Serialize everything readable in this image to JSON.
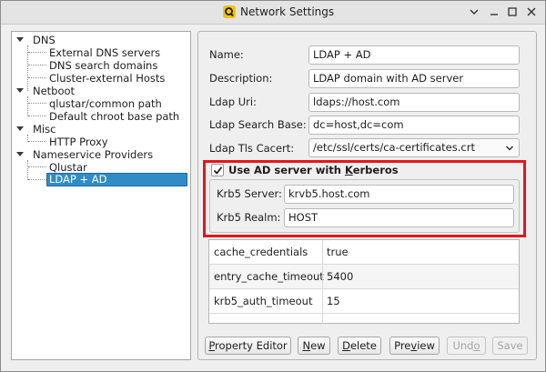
{
  "window": {
    "title": "Network Settings"
  },
  "tree": {
    "items": [
      {
        "label": "DNS",
        "level": 0,
        "expanded": true
      },
      {
        "label": "External DNS servers",
        "level": 1
      },
      {
        "label": "DNS search domains",
        "level": 1
      },
      {
        "label": "Cluster-external Hosts",
        "level": 1
      },
      {
        "label": "Netboot",
        "level": 0,
        "expanded": true
      },
      {
        "label": "qlustar/common path",
        "level": 1
      },
      {
        "label": "Default chroot base path",
        "level": 1
      },
      {
        "label": "Misc",
        "level": 0,
        "expanded": true
      },
      {
        "label": "HTTP Proxy",
        "level": 1
      },
      {
        "label": "Nameservice Providers",
        "level": 0,
        "expanded": true
      },
      {
        "label": "Qlustar",
        "level": 1
      },
      {
        "label": "LDAP + AD",
        "level": 1,
        "selected": true
      }
    ]
  },
  "form": {
    "name_label": "Name:",
    "name_value": "LDAP + AD",
    "description_label": "Description:",
    "description_value": "LDAP domain with AD server",
    "uri_label": "Ldap Uri:",
    "uri_value": "ldaps://host.com",
    "search_base_label": "Ldap Search Base:",
    "search_base_value": "dc=host,dc=com",
    "tls_cacert_label": "Ldap Tls Cacert:",
    "tls_cacert_value": "/etc/ssl/certs/ca-certificates.crt"
  },
  "kerberos": {
    "checkbox_label_prefix": "Use AD server with ",
    "checkbox_label_accel": "K",
    "checkbox_label_suffix": "erberos",
    "checked": true,
    "server_label": "Krb5 Server:",
    "server_value": "krvb5.host.com",
    "realm_label": "Krb5 Realm:",
    "realm_value": "HOST"
  },
  "properties": {
    "rows": [
      {
        "key": "cache_credentials",
        "value": "true"
      },
      {
        "key": "entry_cache_timeout",
        "value": "5400"
      },
      {
        "key": "krb5_auth_timeout",
        "value": "15"
      }
    ]
  },
  "buttons": {
    "property_editor": {
      "accel": "P",
      "rest": "roperty Editor"
    },
    "new": {
      "accel": "N",
      "rest": "ew"
    },
    "delete": {
      "accel": "D",
      "rest": "elete"
    },
    "preview": {
      "pre": "Pre",
      "accel": "v",
      "rest": "iew"
    },
    "undo": {
      "pre": "Und",
      "accel": "o",
      "rest": ""
    },
    "save": {
      "label": "Save"
    }
  },
  "colors": {
    "highlight": "#e8141a",
    "selection": "#308cc6",
    "app_icon": "#f2c20f"
  },
  "icons": {
    "app": "qlustar-app-icon",
    "window_controls": [
      "chevron-down-icon",
      "minimize-icon",
      "maximize-icon",
      "close-icon"
    ]
  }
}
